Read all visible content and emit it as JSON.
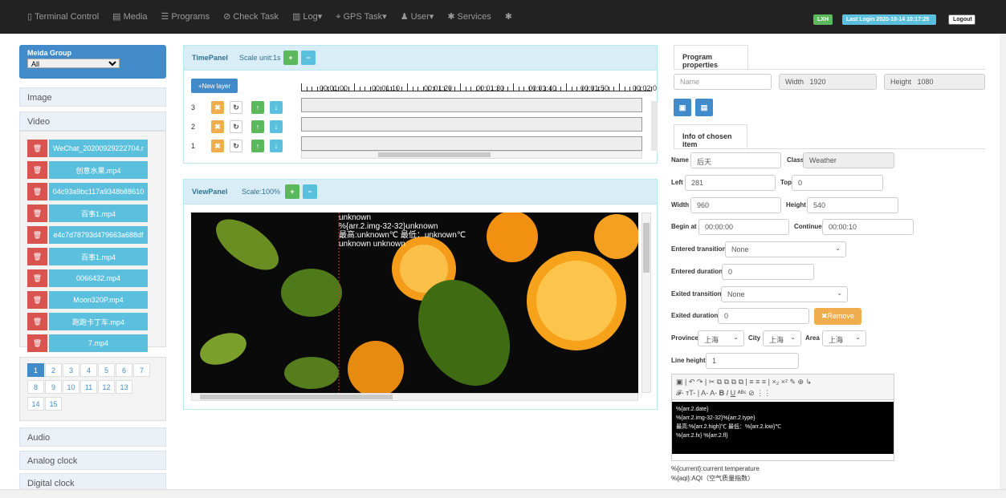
{
  "nav": {
    "items": [
      {
        "icon": "monitor-icon",
        "label": "Terminal Control"
      },
      {
        "icon": "film-icon",
        "label": "Media"
      },
      {
        "icon": "list-icon",
        "label": "Programs"
      },
      {
        "icon": "check-circle-icon",
        "label": "Check Task"
      },
      {
        "icon": "chart-icon",
        "label": "Log▾"
      },
      {
        "icon": "location-icon",
        "label": "GPS Task▾"
      },
      {
        "icon": "user-icon",
        "label": "User▾"
      },
      {
        "icon": "gear-icon",
        "label": "Services"
      },
      {
        "icon": "star-icon",
        "label": ""
      }
    ],
    "user_badge": "LXH",
    "last_login": "Last Login  2020-10-14 10:17:25",
    "logout": "Logout"
  },
  "sidebar": {
    "media_group_title": "Meida Group",
    "media_group_value": "All",
    "sections": [
      "Image",
      "Video",
      "Audio",
      "Analog clock",
      "Digital clock"
    ],
    "videos": [
      "WeChat_20200929222704.r",
      "创意水果.mp4",
      "04c93a9bc117a9348b88610",
      "百事1.mp4",
      "e4c7d78793d479663a688df",
      "百事1.mp4",
      "0066432.mp4",
      "Moon320P.mp4",
      "跑跑卡丁车.mp4",
      "7.mp4"
    ],
    "pages": [
      "1",
      "2",
      "3",
      "4",
      "5",
      "6",
      "7",
      "8",
      "9",
      "10",
      "11",
      "12",
      "13",
      "14",
      "15"
    ],
    "active_page": "1"
  },
  "time_panel": {
    "title": "TimePanel",
    "scale": "Scale unit:1s",
    "new_layer": "+New layer",
    "ticks": [
      "00:01:00",
      "00:01:10",
      "00:01:20",
      "00:01:30",
      "00:01:40",
      "00:01:50",
      "00:02:0"
    ],
    "layers": [
      "3",
      "2",
      "1"
    ]
  },
  "view_panel": {
    "title": "ViewPanel",
    "scale": "Scale:100%",
    "overlay": "unknown\n%{arr.2.img-32-32}unknown\n最高:unknown℃ 最低：unknown℃\nunknown unknown"
  },
  "program_props": {
    "tab": "Program properties",
    "name_placeholder": "Name",
    "width_label": "Width",
    "width_value": "1920",
    "height_label": "Height",
    "height_value": "1080"
  },
  "chosen_item": {
    "tab": "Info of chosen item",
    "name_label": "Name",
    "name_value": "后天",
    "class_label": "Class",
    "class_value": "Weather",
    "left_label": "Left",
    "left_value": "281",
    "top_label": "Top",
    "top_value": "0",
    "width_label": "Width",
    "width_value": "960",
    "height_label": "Height",
    "height_value": "540",
    "begin_label": "Begin at",
    "begin_value": "00:00:00",
    "continue_label": "Continue",
    "continue_value": "00:00:10",
    "entered_transition_label": "Entered transition",
    "entered_transition_value": "None",
    "entered_duration_label": "Entered duration",
    "entered_duration_value": "0",
    "exited_transition_label": "Exited transition",
    "exited_transition_value": "None",
    "exited_duration_label": "Exited duration",
    "exited_duration_value": "0",
    "remove_label": "✖Remove",
    "province_label": "Province",
    "province_value": "上海",
    "city_label": "City",
    "city_value": "上海",
    "area_label": "Area",
    "area_value": "上海",
    "line_height_label": "Line height",
    "line_height_value": "1",
    "editor_text": "%{arr.2.date}\n%{arr.2.img-32-32}%{arr.2.type}\n最高:%{arr.2.high}℃ 最低：%{arr.2.low}℃\n%{arr.2.fx} %{arr.2.fl}",
    "help_lines": [
      "%{current}:current temperature",
      "%{aqi}:AQI（空气质量指数）"
    ]
  }
}
